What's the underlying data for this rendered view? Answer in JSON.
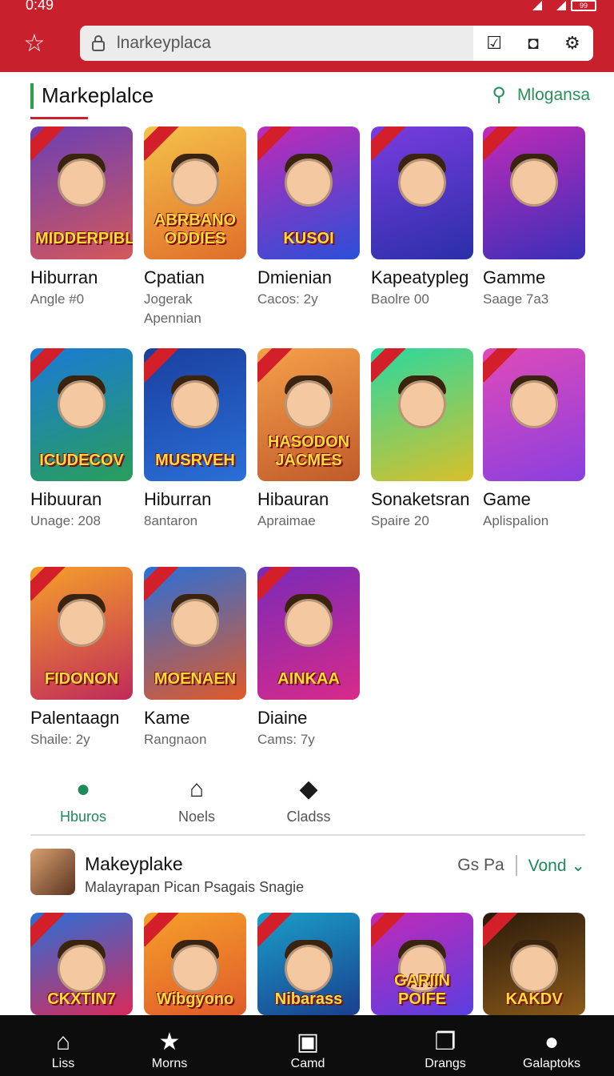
{
  "status": {
    "time": "0:49",
    "battery": "99"
  },
  "toolbar": {
    "url": "lnarkeyplaca"
  },
  "section": {
    "title": "Markeplalce",
    "search_label": "Mlogansa"
  },
  "tiles": [
    {
      "title": "Hiburran",
      "sub1": "Angle #0",
      "sub2": "",
      "art": "MIDDERPIBL",
      "bg": "linear-gradient(160deg,#6a3fb5,#d4585a)"
    },
    {
      "title": "Cpatian",
      "sub1": "Jogerak",
      "sub2": "Apennian",
      "art": "ABRBANO ODDIES",
      "bg": "linear-gradient(160deg,#f5c24a,#e06e2a)"
    },
    {
      "title": "Dmienian",
      "sub1": "Cacos: 2y",
      "sub2": "",
      "art": "KUSOI",
      "bg": "linear-gradient(160deg,#c02ab8,#2a4fd8)"
    },
    {
      "title": "Kapeatypleg",
      "sub1": "Baolre 00",
      "sub2": "",
      "art": "",
      "bg": "linear-gradient(160deg,#7a3ce0,#2a2fa8)"
    },
    {
      "title": "Gamme",
      "sub1": "Saage 7a3",
      "sub2": "",
      "art": "",
      "bg": "linear-gradient(160deg,#c02ab8,#3a2fb8)"
    },
    {
      "title": "Hibuuran",
      "sub1": "Unage: 208",
      "sub2": "",
      "art": "ICUDECOV",
      "bg": "linear-gradient(160deg,#1a7ad8,#2a9e5a)"
    },
    {
      "title": "Hiburran",
      "sub1": "8antaron",
      "sub2": "",
      "art": "MUSRVEH",
      "bg": "linear-gradient(160deg,#1a3f9e,#2a6fd8)"
    },
    {
      "title": "Hibauran",
      "sub1": "Apraimae",
      "sub2": "",
      "art": "HASODON JACMES",
      "bg": "linear-gradient(160deg,#f5a04a,#c05a2a)"
    },
    {
      "title": "Sonaketsran",
      "sub1": "Spaire 20",
      "sub2": "",
      "art": "",
      "bg": "linear-gradient(160deg,#2ad8a0,#d8c02a)"
    },
    {
      "title": "Game",
      "sub1": "Aplispalion",
      "sub2": "",
      "art": "",
      "bg": "linear-gradient(160deg,#e04ab8,#8a3fe0)"
    },
    {
      "title": "Palentaagn",
      "sub1": "Shaile: 2y",
      "sub2": "",
      "art": "FIDONON",
      "bg": "linear-gradient(160deg,#f5a02a,#c02a5a)"
    },
    {
      "title": "Kame",
      "sub1": "Rangnaon",
      "sub2": "",
      "art": "MOENAEN",
      "bg": "linear-gradient(160deg,#2a6fd8,#e05a2a)"
    },
    {
      "title": "Diaine",
      "sub1": "Cams: 7y",
      "sub2": "",
      "art": "AINKAA",
      "bg": "linear-gradient(160deg,#7a2ab8,#d82a8a)"
    }
  ],
  "tabs": [
    {
      "label": "Hburos"
    },
    {
      "label": "Noels"
    },
    {
      "label": "Cladss"
    }
  ],
  "profile": {
    "title": "Makeyplake",
    "subtitle": "Malayrapan Pican Psagais Snagie",
    "gs": "Gs Pa",
    "vond": "Vond"
  },
  "more_tiles": [
    {
      "art": "CKXTIN7",
      "bg": "linear-gradient(160deg,#2a6fd8,#d82a5a)"
    },
    {
      "art": "Wibgyono",
      "bg": "linear-gradient(160deg,#f5a02a,#e05a2a)"
    },
    {
      "art": "Nibarass",
      "bg": "linear-gradient(160deg,#1a9ec8,#1a3f8e)"
    },
    {
      "art": "GARIIN POIFE",
      "bg": "linear-gradient(160deg,#c02ab8,#5a3fe0)"
    },
    {
      "art": "KAKDV",
      "bg": "linear-gradient(160deg,#2a1a0a,#8a5a1a)"
    }
  ],
  "bottom_nav": [
    {
      "label": "Liss",
      "icon": "home-icon",
      "glyph": "⌂"
    },
    {
      "label": "Morns",
      "icon": "star-icon",
      "glyph": "★"
    },
    {
      "label": "Camd",
      "icon": "card-icon",
      "glyph": "▣"
    },
    {
      "label": "Drangs",
      "icon": "copy-icon",
      "glyph": "❐"
    },
    {
      "label": "Galaptoks",
      "icon": "person-icon",
      "glyph": "●"
    }
  ]
}
